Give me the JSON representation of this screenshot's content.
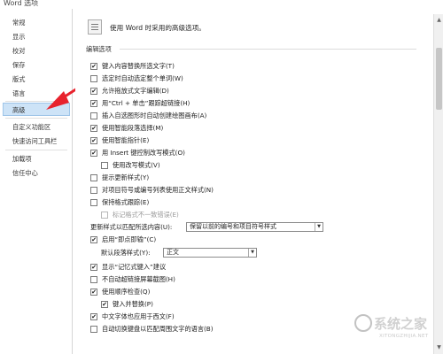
{
  "window": {
    "title": "Word 选项"
  },
  "sidebar": {
    "items": [
      {
        "label": "常规"
      },
      {
        "label": "显示"
      },
      {
        "label": "校对"
      },
      {
        "label": "保存"
      },
      {
        "label": "版式"
      },
      {
        "label": "语言"
      },
      {
        "label": "高级",
        "selected": true
      },
      {
        "label": "自定义功能区"
      },
      {
        "label": "快速访问工具栏"
      },
      {
        "label": "加载项"
      },
      {
        "label": "信任中心"
      }
    ]
  },
  "header": {
    "text": "使用 Word 时采用的高级选项。"
  },
  "section": {
    "title": "编辑选项"
  },
  "options": [
    {
      "label": "键入内容替换所选文字(T)",
      "checked": true
    },
    {
      "label": "选定时自动选定整个单词(W)",
      "checked": false
    },
    {
      "label": "允许拖放式文字编辑(D)",
      "checked": true
    },
    {
      "label": "用“Ctrl + 单击”跟踪超链接(H)",
      "checked": true
    },
    {
      "label": "插入自选图形时自动创建绘图画布(A)",
      "checked": false
    },
    {
      "label": "使用智能段落选择(M)",
      "checked": true
    },
    {
      "label": "使用智能指针(E)",
      "checked": true
    },
    {
      "label": "用 Insert 键控制改写模式(O)",
      "checked": true
    },
    {
      "label": "使用改写模式(V)",
      "checked": false
    },
    {
      "label": "提示更新样式(Y)",
      "checked": false
    },
    {
      "label": "对项目符号或编号列表使用正文样式(N)",
      "checked": false
    },
    {
      "label": "保持格式跟踪(E)",
      "checked": false
    },
    {
      "label": "标记格式不一致错误(E)",
      "checked": false,
      "disabled": true
    },
    {
      "label": "启用“即点即输”(C)",
      "checked": true
    },
    {
      "label": "显示“记忆式键入”建议",
      "checked": true
    },
    {
      "label": "不自动超链接屏幕截图(H)",
      "checked": false
    },
    {
      "label": "使用顺序检查(Q)",
      "checked": true
    },
    {
      "label": "键入并替换(P)",
      "checked": true
    },
    {
      "label": "中文字体也应用于西文(F)",
      "checked": true
    },
    {
      "label": "自动切换键盘以匹配周围文字的语言(B)",
      "checked": false
    }
  ],
  "style_update": {
    "label": "更新样式以匹配所选内容(U):",
    "value": "保留以前的编号和项目符号样式"
  },
  "default_paragraph": {
    "label": "默认段落样式(Y):",
    "value": "正文"
  },
  "icons": {
    "check": "✔",
    "dropdown": "▼",
    "scroll_up": "▲",
    "scroll_down": "▼"
  },
  "watermark": {
    "text": "系统之家",
    "sub": "XITONGZHIJIA.NET"
  },
  "colors": {
    "selected_bg": "#cde3f7",
    "selected_border": "#9ec5e8"
  }
}
